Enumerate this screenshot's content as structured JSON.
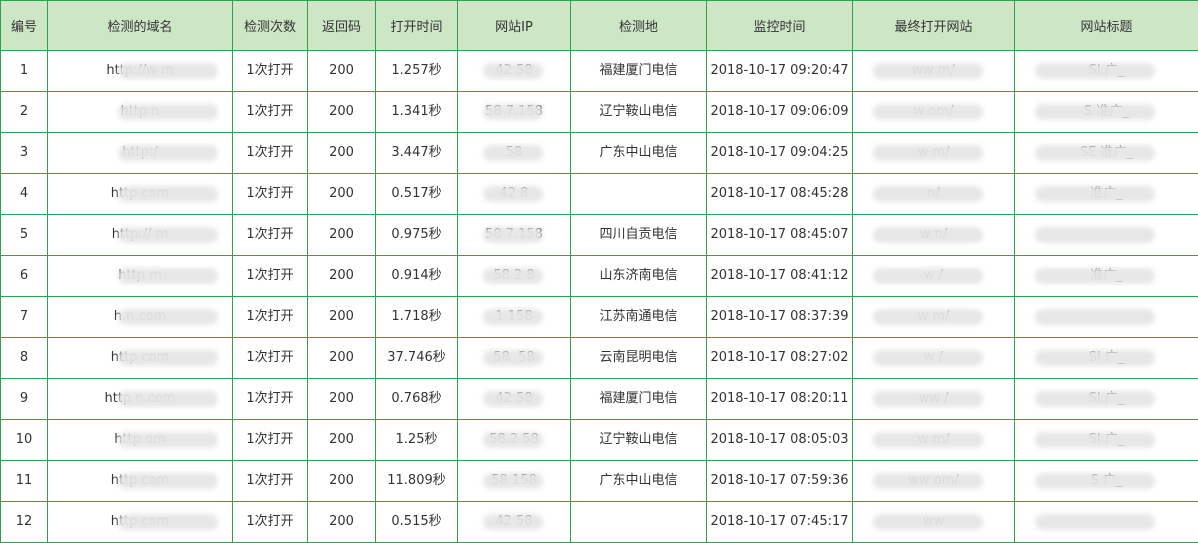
{
  "headers": [
    "编号",
    "检测的域名",
    "检测次数",
    "返回码",
    "打开时间",
    "网站IP",
    "检测地",
    "监控时间",
    "最终打开网站",
    "网站标题"
  ],
  "rows": [
    {
      "id": "1",
      "domain": "http://w              m",
      "count": "1次打开",
      "code": "200",
      "time": "1.257秒",
      "ip": "42          58",
      "location": "福建厦门电信",
      "monitor_time": "2018-10-17 09:20:47",
      "final_site": "ww              m/",
      "title": "SI              广_"
    },
    {
      "id": "2",
      "domain": "http              n",
      "count": "1次打开",
      "code": "200",
      "time": "1.341秒",
      "ip": "58       7.158",
      "location": "辽宁鞍山电信",
      "monitor_time": "2018-10-17 09:06:09",
      "final_site": "w              om/",
      "title": "S              准广_"
    },
    {
      "id": "3",
      "domain": "http:/",
      "count": "1次打开",
      "code": "200",
      "time": "3.447秒",
      "ip": "58",
      "location": "广东中山电信",
      "monitor_time": "2018-10-17 09:04:25",
      "final_site": "w              m/",
      "title": "SE              准广_"
    },
    {
      "id": "4",
      "domain": "http              com",
      "count": "1次打开",
      "code": "200",
      "time": "0.517秒",
      "ip": "42          8",
      "location": "",
      "monitor_time": "2018-10-17 08:45:28",
      "final_site": "              n/",
      "title": "              准广_"
    },
    {
      "id": "5",
      "domain": "http://              m",
      "count": "1次打开",
      "code": "200",
      "time": "0.975秒",
      "ip": "58       7.158",
      "location": "四川自贡电信",
      "monitor_time": "2018-10-17 08:45:07",
      "final_site": "w              n/",
      "title": ""
    },
    {
      "id": "6",
      "domain": "http              m",
      "count": "1次打开",
      "code": "200",
      "time": "0.914秒",
      "ip": "58.2          8",
      "location": "山东济南电信",
      "monitor_time": "2018-10-17 08:41:12",
      "final_site": "w              /",
      "title": "              准广_"
    },
    {
      "id": "7",
      "domain": "h              n.com",
      "count": "1次打开",
      "code": "200",
      "time": "1.718秒",
      "ip": "1          158",
      "location": "江苏南通电信",
      "monitor_time": "2018-10-17 08:37:39",
      "final_site": "w              m/",
      "title": ""
    },
    {
      "id": "8",
      "domain": "http              com",
      "count": "1次打开",
      "code": "200",
      "time": "37.746秒",
      "ip": "58.          58",
      "location": "云南昆明电信",
      "monitor_time": "2018-10-17 08:27:02",
      "final_site": "w              /",
      "title": "SI              广_"
    },
    {
      "id": "9",
      "domain": "http              n.com",
      "count": "1次打开",
      "code": "200",
      "time": "0.768秒",
      "ip": "42          58",
      "location": "福建厦门电信",
      "monitor_time": "2018-10-17 08:20:11",
      "final_site": "ww              /",
      "title": "SI              广_"
    },
    {
      "id": "10",
      "domain": "http              om",
      "count": "1次打开",
      "code": "200",
      "time": "1.25秒",
      "ip": "58.2          58",
      "location": "辽宁鞍山电信",
      "monitor_time": "2018-10-17 08:05:03",
      "final_site": "w              m/",
      "title": "SI              广_"
    },
    {
      "id": "11",
      "domain": "http              com",
      "count": "1次打开",
      "code": "200",
      "time": "11.809秒",
      "ip": "58          158",
      "location": "广东中山电信",
      "monitor_time": "2018-10-17 07:59:36",
      "final_site": "ww              om/",
      "title": "S              广_"
    },
    {
      "id": "12",
      "domain": "http              com",
      "count": "1次打开",
      "code": "200",
      "time": "0.515秒",
      "ip": "42          58",
      "location": "",
      "monitor_time": "2018-10-17 07:45:17",
      "final_site": "ww",
      "title": ""
    }
  ]
}
